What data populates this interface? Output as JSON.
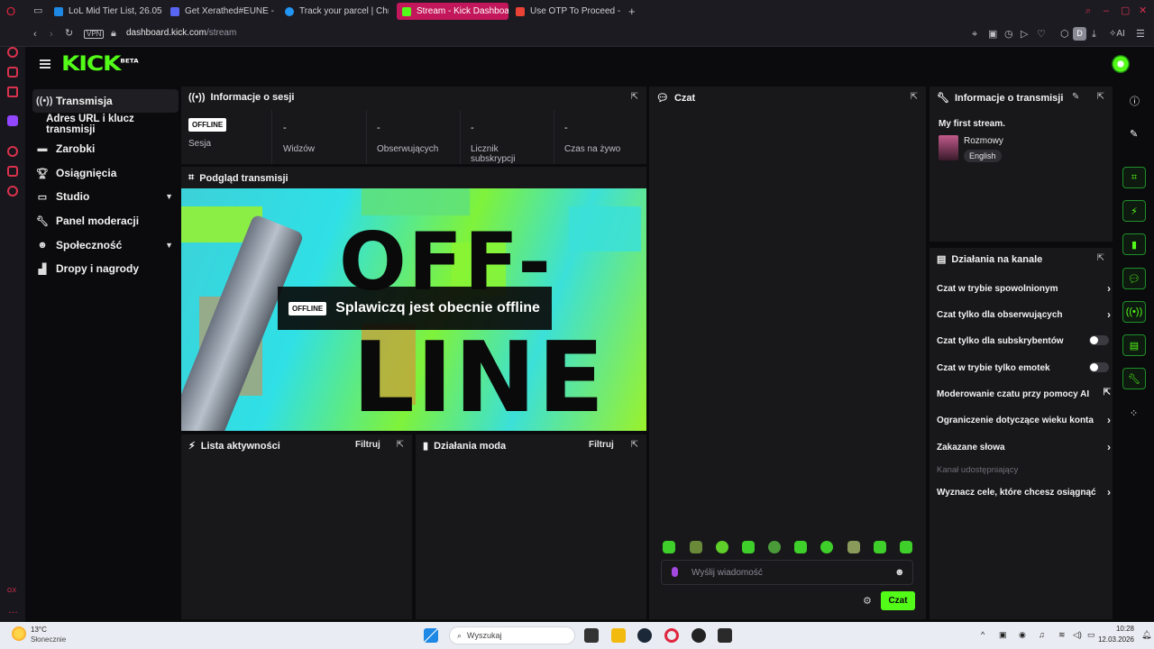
{
  "browser": {
    "tabs": [
      {
        "label": "LoL Mid Tier List, 26.05, B",
        "color": "#1e88e5"
      },
      {
        "label": "Get Xerathed#EUNE - Sta",
        "color": "#5865f2"
      },
      {
        "label": "Track  your parcel | Chron",
        "color": "#2196f3"
      },
      {
        "label": "Stream - Kick Dashboard",
        "color": "#53fc18"
      },
      {
        "label": "Use OTP To Proceed - gre",
        "color": "#ea4335"
      }
    ],
    "url_domain": "dashboard.kick.com",
    "url_path": "/stream",
    "vpn_label": "VPN",
    "ai_label": "AI"
  },
  "kick": {
    "logo": "KICK",
    "logo_badge": "BETA"
  },
  "nav": {
    "items": [
      {
        "label": "Transmisja",
        "icon": "broadcast-icon"
      },
      {
        "label": "Adres URL i klucz transmisji"
      },
      {
        "label": "Zarobki",
        "icon": "money-icon"
      },
      {
        "label": "Osiągnięcia",
        "icon": "trophy-icon"
      },
      {
        "label": "Studio",
        "icon": "studio-icon"
      },
      {
        "label": "Panel moderacji",
        "icon": "wrench-icon"
      },
      {
        "label": "Społeczność",
        "icon": "community-icon"
      },
      {
        "label": "Dropy i nagrody",
        "icon": "drops-icon"
      }
    ]
  },
  "session": {
    "title": "Informacje o sesji",
    "status_badge": "OFFLINE",
    "stats": [
      {
        "label": "Sesja",
        "value": ""
      },
      {
        "label": "Widzów",
        "value": "-"
      },
      {
        "label": "Obserwujących",
        "value": "-"
      },
      {
        "label": "Licznik subskrypcji",
        "value": "-"
      },
      {
        "label": "Czas na żywo",
        "value": "-"
      }
    ]
  },
  "preview": {
    "title": "Podgląd transmisji",
    "bg_text_1": "OFF-",
    "bg_text_2": "LINE",
    "badge": "OFFLINE",
    "message": "Splawiczq jest obecnie offline"
  },
  "activity": {
    "title": "Lista aktywności",
    "filter": "Filtruj"
  },
  "modactions": {
    "title": "Działania moda",
    "filter": "Filtruj"
  },
  "chat": {
    "title": "Czat",
    "placeholder": "Wyślij wiadomość",
    "send": "Czat"
  },
  "stream_info": {
    "title": "Informacje o transmisji",
    "stream_title": "My first stream.",
    "category": "Rozmowy",
    "language": "English"
  },
  "channel_actions": {
    "title": "Działania na kanale",
    "items": [
      {
        "label": "Czat w trybie spowolnionym",
        "control": "arrow"
      },
      {
        "label": "Czat tylko dla obserwujących",
        "control": "arrow"
      },
      {
        "label": "Czat tylko dla subskrybentów",
        "control": "toggle"
      },
      {
        "label": "Czat w trybie tylko emotek",
        "control": "toggle"
      },
      {
        "label": "Moderowanie czatu przy pomocy AI",
        "control": "external"
      },
      {
        "label": "Ograniczenie dotyczące wieku konta",
        "control": "arrow"
      },
      {
        "label": "Zakazane słowa",
        "control": "arrow"
      }
    ],
    "section_label": "Kanał udostępniający",
    "goals": "Wyznacz cele, które chcesz osiągnąć"
  },
  "taskbar": {
    "weather_temp": "13°C",
    "weather_desc": "Słonecznie",
    "search": "Wyszukaj",
    "time": "10:28",
    "date": "12.03.2026"
  },
  "colors": {
    "accent": "#53fc18",
    "tab_active": "#c2185b",
    "panel": "#18181b"
  }
}
